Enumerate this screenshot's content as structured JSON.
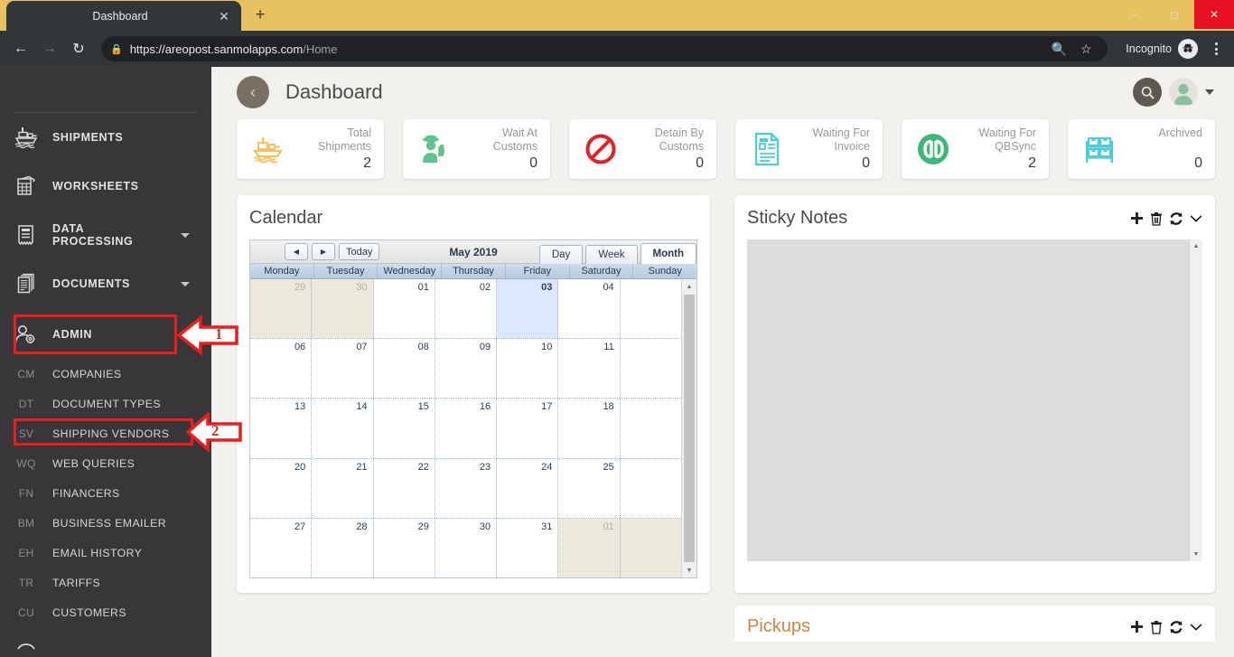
{
  "browser": {
    "tab_title": "Dashboard",
    "tab_close_icon": "close-icon",
    "new_tab_icon": "plus-icon",
    "back_icon": "arrow-left-icon",
    "forward_icon": "arrow-right-icon",
    "reload_icon": "reload-icon",
    "lock_icon": "lock-icon",
    "url_domain": "https://areopost.sanmolapps.com",
    "url_path": "/Home",
    "zoom_icon": "zoom-out-icon",
    "bookmark_icon": "star-icon",
    "profile_label": "Incognito",
    "profile_icon": "incognito-icon",
    "menu_icon": "three-dots-icon",
    "window_minimize": "minimize-icon",
    "window_maximize": "maximize-icon",
    "window_close": "close-icon"
  },
  "sidebar": {
    "items": [
      {
        "label": "SHIPMENTS",
        "icon": "ship-icon",
        "expandable": false
      },
      {
        "label": "WORKSHEETS",
        "icon": "worksheet-icon",
        "expandable": false
      },
      {
        "label": "DATA PROCESSING",
        "icon": "document-lines-icon",
        "expandable": true
      },
      {
        "label": "DOCUMENTS",
        "icon": "documents-stack-icon",
        "expandable": true
      },
      {
        "label": "ADMIN",
        "icon": "user-gear-icon",
        "expandable": true,
        "expanded": true
      }
    ],
    "admin_subitems": [
      {
        "abbr": "CM",
        "label": "COMPANIES"
      },
      {
        "abbr": "DT",
        "label": "DOCUMENT TYPES"
      },
      {
        "abbr": "SV",
        "label": "SHIPPING VENDORS"
      },
      {
        "abbr": "WQ",
        "label": "WEB QUERIES"
      },
      {
        "abbr": "FN",
        "label": "FINANCERS"
      },
      {
        "abbr": "BM",
        "label": "BUSINESS EMAILER"
      },
      {
        "abbr": "EH",
        "label": "EMAIL HISTORY"
      },
      {
        "abbr": "TR",
        "label": "TARIFFS"
      },
      {
        "abbr": "CU",
        "label": "CUSTOMERS"
      }
    ]
  },
  "annotations": {
    "marker_1": "1",
    "marker_2": "2",
    "color": "#ee1c1c"
  },
  "header": {
    "title": "Dashboard",
    "back_icon": "chevron-left-icon",
    "search_icon": "search-icon",
    "avatar_icon": "user-avatar-icon",
    "dropdown_icon": "caret-down-icon"
  },
  "stat_cards": [
    {
      "label_line1": "Total",
      "label_line2": "Shipments",
      "value": "2",
      "icon": "ship-icon",
      "color": "#f5c163"
    },
    {
      "label_line1": "Wait At",
      "label_line2": "Customs",
      "value": "0",
      "icon": "customs-officer-icon",
      "color": "#5ec48d"
    },
    {
      "label_line1": "Detain By",
      "label_line2": "Customs",
      "value": "0",
      "icon": "no-entry-icon",
      "color": "#e52020"
    },
    {
      "label_line1": "Waiting For",
      "label_line2": "Invoice",
      "value": "0",
      "icon": "invoice-icon",
      "color": "#4ecdd6"
    },
    {
      "label_line1": "Waiting For",
      "label_line2": "QBSync",
      "value": "2",
      "icon": "quickbooks-icon",
      "color": "#3cb878"
    },
    {
      "label_line1": "Archived",
      "label_line2": "",
      "value": "0",
      "icon": "archive-boxes-icon",
      "color": "#4ecdd6"
    }
  ],
  "calendar": {
    "panel_title": "Calendar",
    "prev_icon": "triangle-left-icon",
    "next_icon": "triangle-right-icon",
    "today_button": "Today",
    "month_label": "May 2019",
    "views": [
      {
        "label": "Day",
        "active": false
      },
      {
        "label": "Week",
        "active": false
      },
      {
        "label": "Month",
        "active": true
      }
    ],
    "day_names": [
      "Monday",
      "Tuesday",
      "Wednesday",
      "Thursday",
      "Friday",
      "Saturday",
      "Sunday"
    ],
    "weeks": [
      [
        {
          "d": "29",
          "other": true
        },
        {
          "d": "30",
          "other": true
        },
        {
          "d": "01"
        },
        {
          "d": "02"
        },
        {
          "d": "03",
          "today": true
        },
        {
          "d": "04"
        },
        {
          "d": ""
        }
      ],
      [
        {
          "d": "06"
        },
        {
          "d": "07"
        },
        {
          "d": "08"
        },
        {
          "d": "09"
        },
        {
          "d": "10"
        },
        {
          "d": "11"
        },
        {
          "d": ""
        }
      ],
      [
        {
          "d": "13"
        },
        {
          "d": "14"
        },
        {
          "d": "15"
        },
        {
          "d": "16"
        },
        {
          "d": "17"
        },
        {
          "d": "18"
        },
        {
          "d": ""
        }
      ],
      [
        {
          "d": "20"
        },
        {
          "d": "21"
        },
        {
          "d": "22"
        },
        {
          "d": "23"
        },
        {
          "d": "24"
        },
        {
          "d": "25"
        },
        {
          "d": ""
        }
      ],
      [
        {
          "d": "27"
        },
        {
          "d": "28"
        },
        {
          "d": "29"
        },
        {
          "d": "30"
        },
        {
          "d": "31"
        },
        {
          "d": "01",
          "other": true
        },
        {
          "d": ""
        }
      ]
    ],
    "scroll_up_icon": "triangle-up-icon",
    "scroll_down_icon": "triangle-down-icon"
  },
  "sticky_notes": {
    "panel_title": "Sticky Notes",
    "tools": [
      {
        "icon": "plus-icon",
        "name": "add-note"
      },
      {
        "icon": "trash-icon",
        "name": "delete-note"
      },
      {
        "icon": "refresh-icon",
        "name": "refresh-notes"
      },
      {
        "icon": "chevron-down-icon",
        "name": "collapse-panel"
      }
    ],
    "content": "",
    "scroll_up_icon": "triangle-up-icon",
    "scroll_down_icon": "triangle-down-icon"
  },
  "pickups": {
    "panel_title": "Pickups",
    "tools": [
      {
        "icon": "plus-icon",
        "name": "add-pickup"
      },
      {
        "icon": "trash-icon",
        "name": "delete-pickup"
      },
      {
        "icon": "refresh-icon",
        "name": "refresh-pickups"
      },
      {
        "icon": "chevron-down-icon",
        "name": "collapse-panel"
      }
    ]
  }
}
